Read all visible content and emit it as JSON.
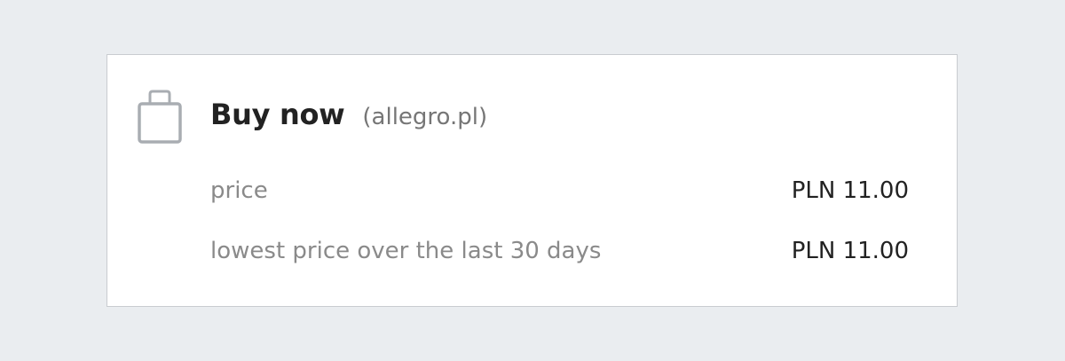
{
  "offer": {
    "icon": "shopping-bag-icon",
    "title": "Buy now",
    "source": "(allegro.pl)",
    "rows": [
      {
        "label": "price",
        "value": "PLN 11.00"
      },
      {
        "label": "lowest price over the last 30 days",
        "value": "PLN 11.00"
      }
    ]
  },
  "colors": {
    "background": "#eaedf0",
    "card": "#ffffff",
    "border": "#c9ccd0",
    "icon": "#a9adb2",
    "title": "#222222",
    "muted_text": "#8a8a8a"
  }
}
